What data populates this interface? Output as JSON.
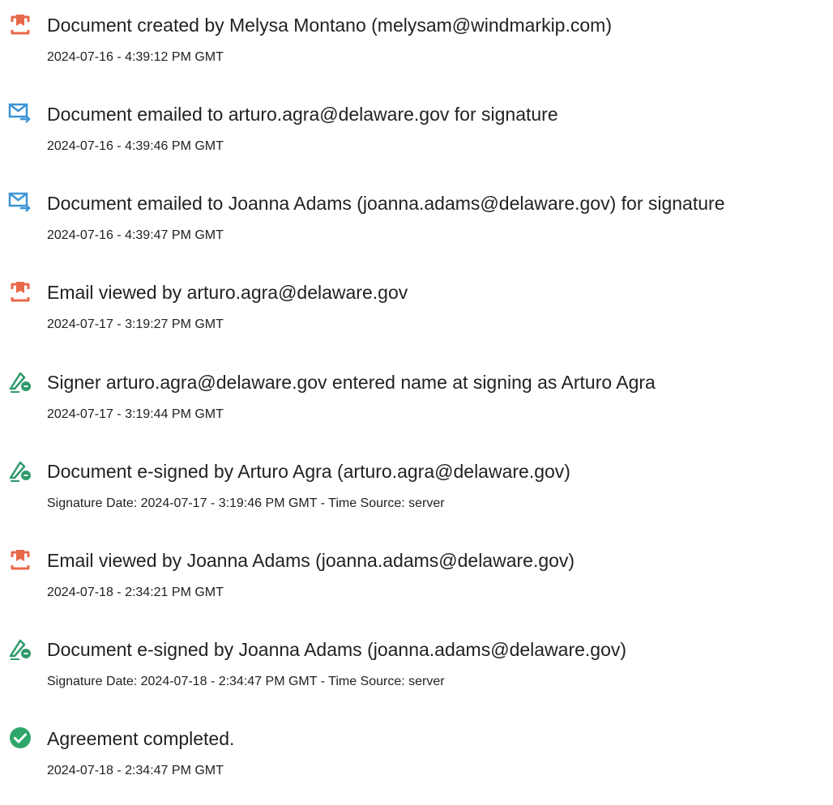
{
  "events": [
    {
      "type": "document",
      "icon": "document-icon",
      "title": "Document created by Melysa Montano (melysam@windmarkip.com)",
      "detail": "2024-07-16 - 4:39:12 PM GMT"
    },
    {
      "type": "email",
      "icon": "email-sent-icon",
      "title": "Document emailed to arturo.agra@delaware.gov for signature",
      "detail": "2024-07-16 - 4:39:46 PM GMT"
    },
    {
      "type": "email",
      "icon": "email-sent-icon",
      "title": "Document emailed to Joanna Adams (joanna.adams@delaware.gov) for signature",
      "detail": "2024-07-16 - 4:39:47 PM GMT"
    },
    {
      "type": "document",
      "icon": "document-icon",
      "title": "Email viewed by arturo.agra@delaware.gov",
      "detail": "2024-07-17 - 3:19:27 PM GMT"
    },
    {
      "type": "sign",
      "icon": "e-sign-pen-icon",
      "title": "Signer arturo.agra@delaware.gov entered name at signing as Arturo Agra",
      "detail": "2024-07-17 - 3:19:44 PM GMT"
    },
    {
      "type": "sign",
      "icon": "e-sign-pen-icon",
      "title": "Document e-signed by Arturo Agra (arturo.agra@delaware.gov)",
      "detail": "Signature Date: 2024-07-17 - 3:19:46 PM GMT - Time Source: server"
    },
    {
      "type": "document",
      "icon": "document-icon",
      "title": "Email viewed by Joanna Adams (joanna.adams@delaware.gov)",
      "detail": "2024-07-18 - 2:34:21 PM GMT"
    },
    {
      "type": "sign",
      "icon": "e-sign-pen-icon",
      "title": "Document e-signed by Joanna Adams (joanna.adams@delaware.gov)",
      "detail": "Signature Date: 2024-07-18 - 2:34:47 PM GMT - Time Source: server"
    },
    {
      "type": "complete",
      "icon": "check-circle-icon",
      "title": "Agreement completed.",
      "detail": "2024-07-18 - 2:34:47 PM GMT"
    }
  ],
  "colors": {
    "document_icon": "#e8684a",
    "email_icon": "#3d94d6",
    "sign_icon": "#2f9a6a",
    "complete_icon": "#2ea66a",
    "text": "#222222"
  }
}
